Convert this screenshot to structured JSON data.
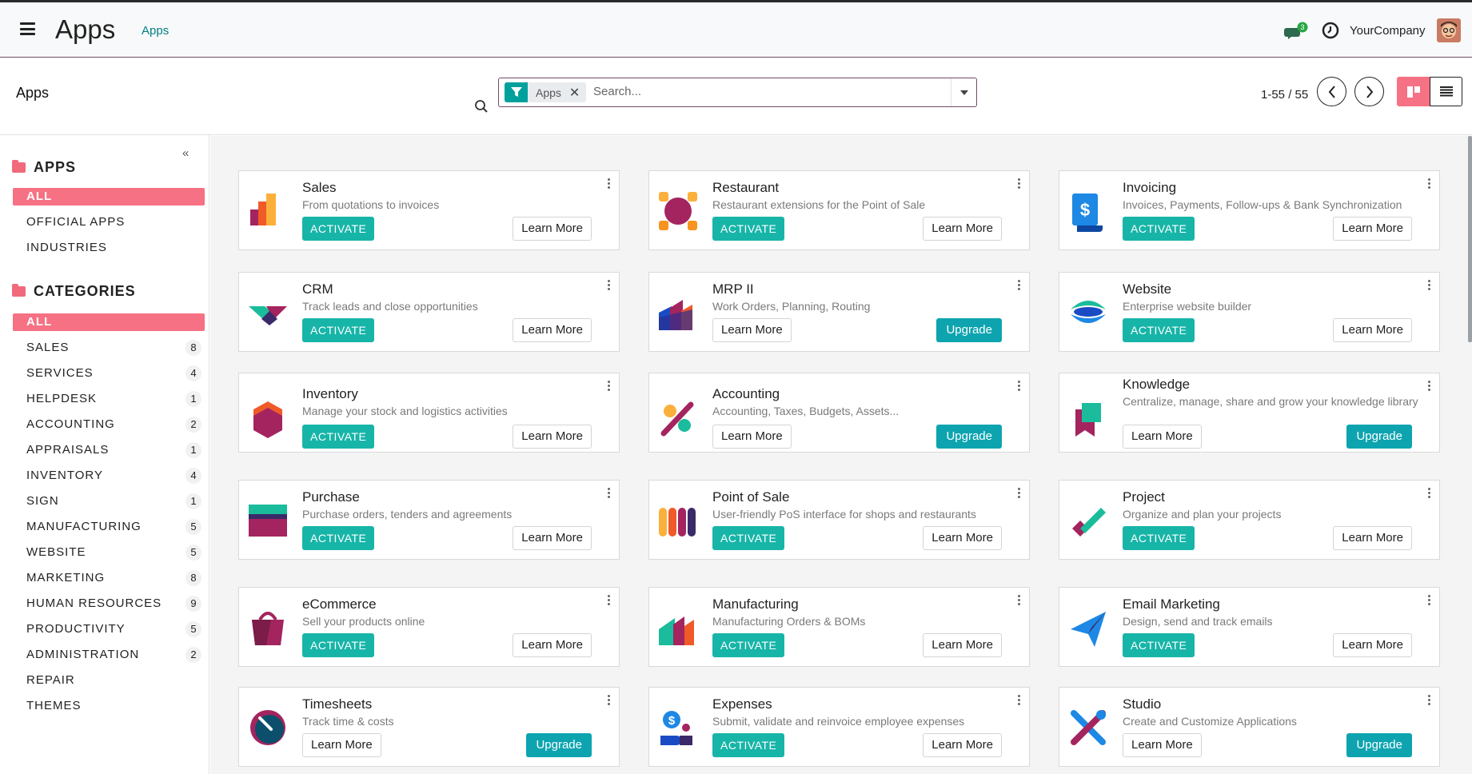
{
  "navbar": {
    "title": "Apps",
    "breadcrumb": "Apps",
    "company": "YourCompany",
    "chat_badge": "3"
  },
  "control_panel": {
    "title": "Apps",
    "facet_label": "Apps",
    "search_placeholder": "Search...",
    "pager": "1-55 / 55"
  },
  "sidebar": {
    "collapse": "«",
    "apps_header": "APPS",
    "apps_items": [
      "ALL",
      "OFFICIAL APPS",
      "INDUSTRIES"
    ],
    "categories_header": "CATEGORIES",
    "categories": [
      {
        "label": "ALL",
        "count": ""
      },
      {
        "label": "SALES",
        "count": "8"
      },
      {
        "label": "SERVICES",
        "count": "4"
      },
      {
        "label": "HELPDESK",
        "count": "1"
      },
      {
        "label": "ACCOUNTING",
        "count": "2"
      },
      {
        "label": "APPRAISALS",
        "count": "1"
      },
      {
        "label": "INVENTORY",
        "count": "4"
      },
      {
        "label": "SIGN",
        "count": "1"
      },
      {
        "label": "MANUFACTURING",
        "count": "5"
      },
      {
        "label": "WEBSITE",
        "count": "5"
      },
      {
        "label": "MARKETING",
        "count": "8"
      },
      {
        "label": "HUMAN RESOURCES",
        "count": "9"
      },
      {
        "label": "PRODUCTIVITY",
        "count": "5"
      },
      {
        "label": "ADMINISTRATION",
        "count": "2"
      },
      {
        "label": "REPAIR",
        "count": ""
      },
      {
        "label": "THEMES",
        "count": ""
      }
    ]
  },
  "buttons": {
    "activate": "ACTIVATE",
    "learn_more": "Learn More",
    "upgrade": "Upgrade"
  },
  "apps": [
    {
      "name": "Sales",
      "desc": "From quotations to invoices",
      "mode": "activate",
      "icon": "sales-icon"
    },
    {
      "name": "Restaurant",
      "desc": "Restaurant extensions for the Point of Sale",
      "mode": "activate",
      "icon": "restaurant-icon"
    },
    {
      "name": "Invoicing",
      "desc": "Invoices, Payments, Follow-ups & Bank Synchronization",
      "mode": "activate",
      "icon": "invoicing-icon"
    },
    {
      "name": "CRM",
      "desc": "Track leads and close opportunities",
      "mode": "activate",
      "icon": "crm-icon"
    },
    {
      "name": "MRP II",
      "desc": "Work Orders, Planning, Routing",
      "mode": "upgrade",
      "icon": "mrp-icon"
    },
    {
      "name": "Website",
      "desc": "Enterprise website builder",
      "mode": "activate",
      "icon": "website-icon"
    },
    {
      "name": "Inventory",
      "desc": "Manage your stock and logistics activities",
      "mode": "activate",
      "icon": "inventory-icon"
    },
    {
      "name": "Accounting",
      "desc": "Accounting, Taxes, Budgets, Assets...",
      "mode": "upgrade",
      "icon": "accounting-icon"
    },
    {
      "name": "Knowledge",
      "desc": "Centralize, manage, share and grow your knowledge library",
      "mode": "upgrade",
      "icon": "knowledge-icon"
    },
    {
      "name": "Purchase",
      "desc": "Purchase orders, tenders and agreements",
      "mode": "activate",
      "icon": "purchase-icon"
    },
    {
      "name": "Point of Sale",
      "desc": "User-friendly PoS interface for shops and restaurants",
      "mode": "activate",
      "icon": "point-of-sale-icon"
    },
    {
      "name": "Project",
      "desc": "Organize and plan your projects",
      "mode": "activate",
      "icon": "project-icon"
    },
    {
      "name": "eCommerce",
      "desc": "Sell your products online",
      "mode": "activate",
      "icon": "ecommerce-icon"
    },
    {
      "name": "Manufacturing",
      "desc": "Manufacturing Orders & BOMs",
      "mode": "activate",
      "icon": "manufacturing-icon"
    },
    {
      "name": "Email Marketing",
      "desc": "Design, send and track emails",
      "mode": "activate",
      "icon": "email-marketing-icon"
    },
    {
      "name": "Timesheets",
      "desc": "Track time & costs",
      "mode": "upgrade",
      "icon": "timesheets-icon"
    },
    {
      "name": "Expenses",
      "desc": "Submit, validate and reinvoice employee expenses",
      "mode": "activate",
      "icon": "expenses-icon"
    },
    {
      "name": "Studio",
      "desc": "Create and Customize Applications",
      "mode": "upgrade",
      "icon": "studio-icon"
    }
  ]
}
